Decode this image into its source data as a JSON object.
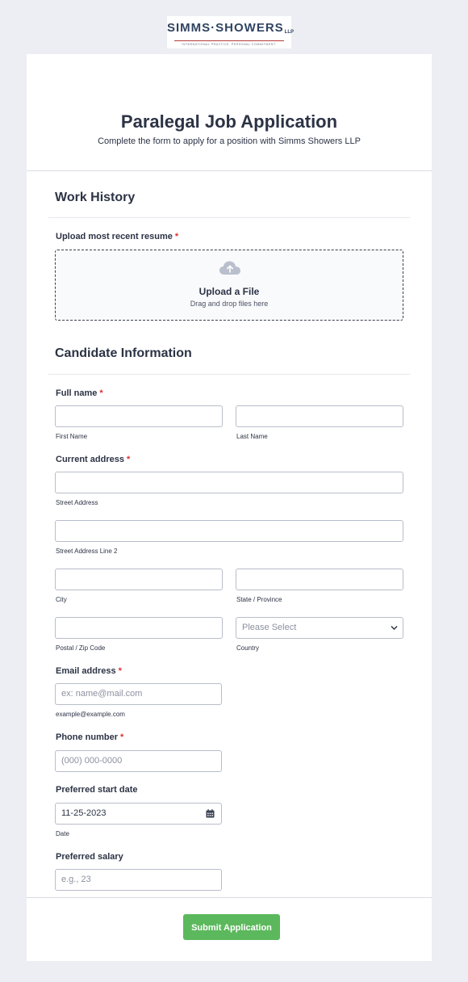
{
  "logo": {
    "name": "SIMMS·SHOWERS",
    "suffix": "LLP",
    "tagline": "INTERNATIONAL PRACTICE. PERSONAL COMMITMENT."
  },
  "form": {
    "title": "Paralegal Job Application",
    "subtitle": "Complete the form to apply for a position with Simms Showers LLP"
  },
  "work_history": {
    "heading": "Work History",
    "resume_label": "Upload most recent resume",
    "required_mark": "*",
    "upload_title": "Upload a File",
    "upload_sub": "Drag and drop files here"
  },
  "candidate": {
    "heading": "Candidate Information",
    "full_name_label": "Full name",
    "first_name_sub": "First Name",
    "last_name_sub": "Last Name",
    "address_label": "Current address",
    "street_sub": "Street Address",
    "street2_sub": "Street Address Line 2",
    "city_sub": "City",
    "state_sub": "State / Province",
    "zip_sub": "Postal / Zip Code",
    "country_sub": "Country",
    "country_placeholder": "Please Select",
    "email_label": "Email address",
    "email_placeholder": "ex: name@mail.com",
    "email_sub": "example@example.com",
    "phone_label": "Phone number",
    "phone_placeholder": "(000) 000-0000",
    "start_label": "Preferred start date",
    "start_value": "11-25-2023",
    "start_sub": "Date",
    "salary_label": "Preferred salary",
    "salary_placeholder": "e.g., 23"
  },
  "submit_label": "Submit Application",
  "colors": {
    "background": "#eceef3",
    "card": "#ffffff",
    "text": "#2c3345",
    "required": "#e03131",
    "submit": "#5cb85c"
  }
}
